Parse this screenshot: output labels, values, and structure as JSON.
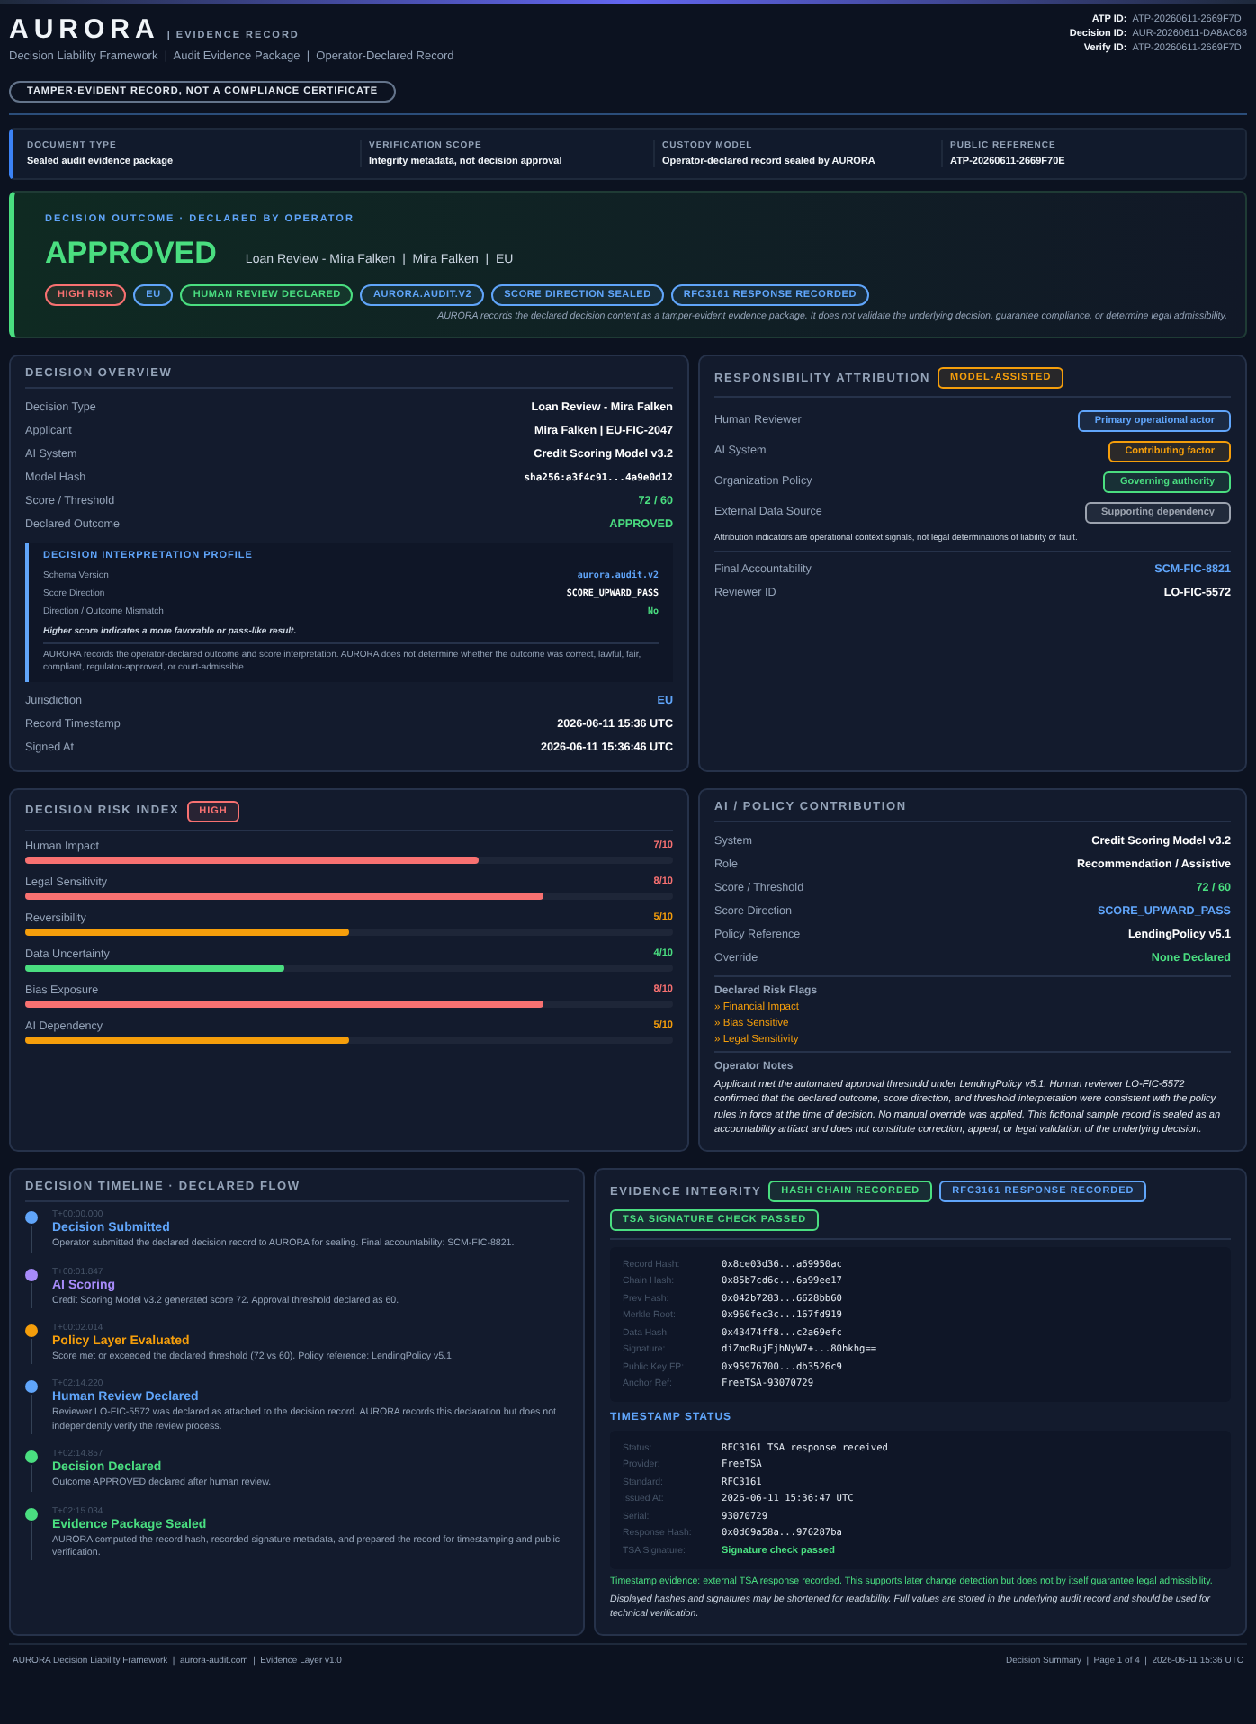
{
  "header": {
    "brand": "AURORA",
    "record_label": "| EVIDENCE RECORD",
    "breadcrumbs": "Decision Liability Framework  |  Audit Evidence Package  |  Operator-Declared Record",
    "disclaimer": "TAMPER-EVIDENT RECORD, NOT A COMPLIANCE CERTIFICATE",
    "ids": [
      {
        "label": "ATP ID:",
        "value": "ATP-20260611-2669F7D"
      },
      {
        "label": "Decision ID:",
        "value": "AUR-20260611-DA8AC68"
      },
      {
        "label": "Verify ID:",
        "value": "ATP-20260611-2669F7D"
      }
    ]
  },
  "info_strip": [
    {
      "label": "DOCUMENT TYPE",
      "value": "Sealed audit evidence package"
    },
    {
      "label": "VERIFICATION SCOPE",
      "value": "Integrity metadata, not decision approval"
    },
    {
      "label": "CUSTODY MODEL",
      "value": "Operator-declared record sealed by AURORA"
    },
    {
      "label": "PUBLIC REFERENCE",
      "value": "ATP-20260611-2669F70E"
    }
  ],
  "outcome": {
    "heading": "DECISION OUTCOME · DECLARED BY OPERATOR",
    "result": "APPROVED",
    "context": "Loan Review - Mira Falken  |  Mira Falken  |  EU",
    "tags": [
      {
        "text": "HIGH RISK",
        "color": "#f87171"
      },
      {
        "text": "EU",
        "color": "#60a5fa"
      },
      {
        "text": "HUMAN REVIEW DECLARED",
        "color": "#4ade80"
      },
      {
        "text": "AURORA.AUDIT.V2",
        "color": "#60a5fa"
      },
      {
        "text": "SCORE DIRECTION SEALED",
        "color": "#60a5fa"
      },
      {
        "text": "RFC3161 RESPONSE RECORDED",
        "color": "#60a5fa"
      }
    ],
    "note": "AURORA records the declared decision content as a tamper-evident evidence package. It does not validate the underlying decision, guarantee compliance, or determine legal admissibility."
  },
  "overview": {
    "title": "DECISION OVERVIEW",
    "rows": [
      {
        "label": "Decision Type",
        "value": "Loan Review - Mira Falken",
        "color": "#ffffff",
        "kind": "text"
      },
      {
        "label": "Applicant",
        "value": "Mira Falken | EU-FIC-2047",
        "color": "#ffffff",
        "kind": "text"
      },
      {
        "label": "AI System",
        "value": "Credit Scoring Model v3.2",
        "color": "#ffffff",
        "kind": "text"
      },
      {
        "label": "Model Hash",
        "value": "sha256:a3f4c91...4a9e0d12",
        "color": "#ffffff",
        "kind": "mono"
      },
      {
        "label": "Score / Threshold",
        "value": "72 / 60",
        "color": "#4ade80",
        "kind": "text"
      },
      {
        "label": "Declared Outcome",
        "value": "APPROVED",
        "color": "#4ade80",
        "kind": "text"
      }
    ],
    "profile": {
      "title": "DECISION INTERPRETATION PROFILE",
      "rows": [
        {
          "label": "Schema Version",
          "value": "aurora.audit.v2",
          "color": "#60a5fa"
        },
        {
          "label": "Score Direction",
          "value": "SCORE_UPWARD_PASS",
          "color": "#ffffff"
        },
        {
          "label": "Direction / Outcome Mismatch",
          "value": "No",
          "color": "#4ade80"
        }
      ],
      "hint": "Higher score indicates a more favorable or pass-like result.",
      "note": "AURORA records the operator-declared outcome and score interpretation. AURORA does not determine whether the outcome was correct, lawful, fair, compliant, regulator-approved, or court-admissible."
    },
    "rows_after": [
      {
        "label": "Jurisdiction",
        "value": "EU",
        "color": "#60a5fa",
        "kind": "text"
      },
      {
        "label": "Record Timestamp",
        "value": "2026-06-11 15:36 UTC",
        "color": "#ffffff",
        "kind": "text"
      },
      {
        "label": "Signed At",
        "value": "2026-06-11 15:36:46 UTC",
        "color": "#ffffff",
        "kind": "text"
      }
    ]
  },
  "attribution": {
    "title": "RESPONSIBILITY ATTRIBUTION",
    "badge": "MODEL-ASSISTED",
    "rows": [
      {
        "label": "Human Reviewer",
        "role": "Primary operational actor",
        "color": "#60a5fa"
      },
      {
        "label": "AI System",
        "role": "Contributing factor",
        "color": "#f59e0b"
      },
      {
        "label": "Organization Policy",
        "role": "Governing authority",
        "color": "#4ade80"
      },
      {
        "label": "External Data Source",
        "role": "Supporting dependency",
        "color": "#9ca3af"
      }
    ],
    "note": "Attribution indicators are operational context signals, not legal determinations of liability or fault.",
    "ids": [
      {
        "label": "Final Accountability",
        "value": "SCM-FIC-8821",
        "color": "#60a5fa",
        "kind": "text"
      },
      {
        "label": "Reviewer ID",
        "value": "LO-FIC-5572",
        "color": "#ffffff",
        "kind": "text"
      }
    ]
  },
  "risk": {
    "title": "DECISION RISK INDEX",
    "badge": "HIGH",
    "factors": [
      {
        "label": "Human Impact",
        "reading": "7/10",
        "level": 0.7,
        "color": "#f87171"
      },
      {
        "label": "Legal Sensitivity",
        "reading": "8/10",
        "level": 0.8,
        "color": "#f87171"
      },
      {
        "label": "Reversibility",
        "reading": "5/10",
        "level": 0.5,
        "color": "#f59e0b"
      },
      {
        "label": "Data Uncertainty",
        "reading": "4/10",
        "level": 0.4,
        "color": "#4ade80"
      },
      {
        "label": "Bias Exposure",
        "reading": "8/10",
        "level": 0.8,
        "color": "#f87171"
      },
      {
        "label": "AI Dependency",
        "reading": "5/10",
        "level": 0.5,
        "color": "#f59e0b"
      }
    ]
  },
  "policy": {
    "title": "AI / POLICY CONTRIBUTION",
    "rows": [
      {
        "label": "System",
        "value": "Credit Scoring Model v3.2",
        "color": "#ffffff",
        "kind": "text"
      },
      {
        "label": "Role",
        "value": "Recommendation / Assistive",
        "color": "#ffffff",
        "kind": "text"
      },
      {
        "label": "Score / Threshold",
        "value": "72 / 60",
        "color": "#4ade80",
        "kind": "text"
      },
      {
        "label": "Score Direction",
        "value": "SCORE_UPWARD_PASS",
        "color": "#60a5fa",
        "kind": "text"
      },
      {
        "label": "Policy Reference",
        "value": "LendingPolicy v5.1",
        "color": "#ffffff",
        "kind": "text"
      },
      {
        "label": "Override",
        "value": "None Declared",
        "color": "#4ade80",
        "kind": "text"
      }
    ],
    "flags_title": "Declared Risk Flags",
    "flags": [
      "» Financial Impact",
      "» Bias Sensitive",
      "» Legal Sensitivity"
    ],
    "notes_title": "Operator Notes",
    "notes": "Applicant met the automated approval threshold under LendingPolicy v5.1. Human reviewer LO-FIC-5572 confirmed that the declared outcome, score direction, and threshold interpretation were consistent with the policy rules in force at the time of decision. No manual override was applied. This fictional sample record is sealed as an accountability artifact and does not constitute correction, appeal, or legal validation of the underlying decision."
  },
  "timeline": {
    "title": "DECISION TIMELINE · DECLARED FLOW",
    "events": [
      {
        "time": "T+00:00.000",
        "title": "Decision Submitted",
        "text": "Operator submitted the declared decision record to AURORA for sealing. Final accountability: SCM-FIC-8821.",
        "color": "#60a5fa"
      },
      {
        "time": "T+00:01.847",
        "title": "AI Scoring",
        "text": "Credit Scoring Model v3.2 generated score 72. Approval threshold declared as 60.",
        "color": "#a78bfa"
      },
      {
        "time": "T+00:02.014",
        "title": "Policy Layer Evaluated",
        "text": "Score met or exceeded the declared threshold (72 vs 60). Policy reference: LendingPolicy v5.1.",
        "color": "#f59e0b"
      },
      {
        "time": "T+02:14.220",
        "title": "Human Review Declared",
        "text": "Reviewer LO-FIC-5572 was declared as attached to the decision record. AURORA records this declaration but does not independently verify the review process.",
        "color": "#60a5fa"
      },
      {
        "time": "T+02:14.857",
        "title": "Decision Declared",
        "text": "Outcome APPROVED declared after human review.",
        "color": "#4ade80"
      },
      {
        "time": "T+02:15.034",
        "title": "Evidence Package Sealed",
        "text": "AURORA computed the record hash, recorded signature metadata, and prepared the record for timestamping and public verification.",
        "color": "#4ade80"
      }
    ]
  },
  "integrity": {
    "title": "EVIDENCE INTEGRITY",
    "badges": [
      {
        "text": "HASH CHAIN RECORDED",
        "color": "#4ade80"
      },
      {
        "text": "RFC3161 RESPONSE RECORDED",
        "color": "#60a5fa"
      },
      {
        "text": "TSA SIGNATURE CHECK PASSED",
        "color": "#4ade80"
      }
    ],
    "hashes": [
      {
        "label": "Record Hash:",
        "value": "0x8ce03d36...a69950ac"
      },
      {
        "label": "Chain Hash:",
        "value": "0x85b7cd6c...6a99ee17"
      },
      {
        "label": "Prev Hash:",
        "value": "0x042b7283...6628bb60"
      },
      {
        "label": "Merkle Root:",
        "value": "0x960fec3c...167fd919"
      },
      {
        "label": "Data Hash:",
        "value": "0x43474ff8...c2a69efc"
      },
      {
        "label": "Signature:",
        "value": "diZmdRujEjhNyW7+...80hkhg=="
      },
      {
        "label": "Public Key FP:",
        "value": "0x95976700...db3526c9"
      },
      {
        "label": "Anchor Ref:",
        "value": "FreeTSA-93070729"
      }
    ],
    "timestamp_title": "TIMESTAMP STATUS",
    "timestamp": [
      {
        "label": "Status:",
        "value": "RFC3161 TSA response received",
        "kind": "mono"
      },
      {
        "label": "Provider:",
        "value": "FreeTSA",
        "kind": "mono"
      },
      {
        "label": "Standard:",
        "value": "RFC3161",
        "kind": "mono"
      },
      {
        "label": "Issued At:",
        "value": "2026-06-11 15:36:47 UTC",
        "kind": "mono"
      },
      {
        "label": "Serial:",
        "value": "93070729",
        "kind": "mono"
      },
      {
        "label": "Response Hash:",
        "value": "0x0d69a58a...976287ba",
        "kind": "mono"
      },
      {
        "label": "TSA Signature:",
        "value": "Signature check passed",
        "kind": "status"
      }
    ],
    "evidence_note": "Timestamp evidence: external TSA response recorded. This supports later change detection but does not by itself guarantee legal admissibility.",
    "display_note": "Displayed hashes and signatures may be shortened for readability. Full values are stored in the underlying audit record and should be used for technical verification."
  },
  "footer": {
    "left": "AURORA Decision Liability Framework  |  aurora-audit.com  |  Evidence Layer v1.0",
    "right": "Decision Summary  |  Page 1 of 4  |  2026-06-11 15:36 UTC"
  }
}
